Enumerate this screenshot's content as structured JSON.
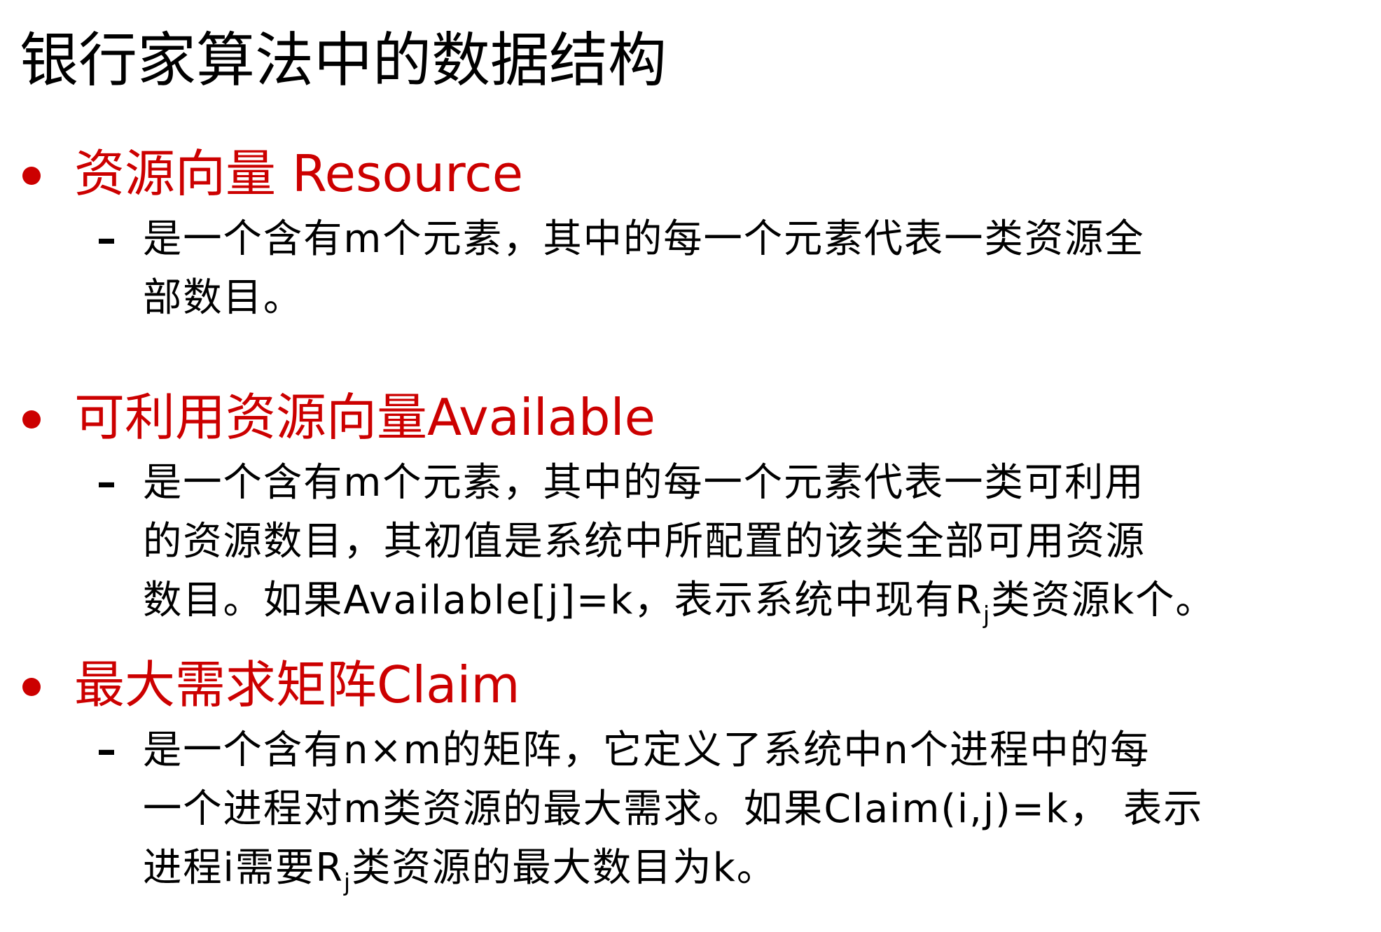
{
  "title": "银行家算法中的数据结构",
  "colors": {
    "accent": "#cc0000",
    "text": "#000000",
    "background": "#ffffff"
  },
  "sections": [
    {
      "heading": "资源向量 Resource",
      "dash": "–",
      "lines": [
        "是一个含有m个元素，其中的每一个元素代表一类资源全",
        "部数目。"
      ]
    },
    {
      "heading": "可利用资源向量Available",
      "dash": "–",
      "lines": [
        "是一个含有m个元素，其中的每一个元素代表一类可利用",
        "的资源数目，其初值是系统中所配置的该类全部可用资源"
      ],
      "line3_pre": "数目。如果Available[j]=k，表示系统中现有R",
      "line3_sub": "j",
      "line3_post": "类资源k个。"
    },
    {
      "heading": "最大需求矩阵Claim",
      "dash": "–",
      "lines": [
        "是一个含有n×m的矩阵，它定义了系统中n个进程中的每",
        "一个进程对m类资源的最大需求。如果Claim(i,j)=k，  表示"
      ],
      "line3_pre": "进程i需要R",
      "line3_sub": "j",
      "line3_post": "类资源的最大数目为k。"
    }
  ]
}
